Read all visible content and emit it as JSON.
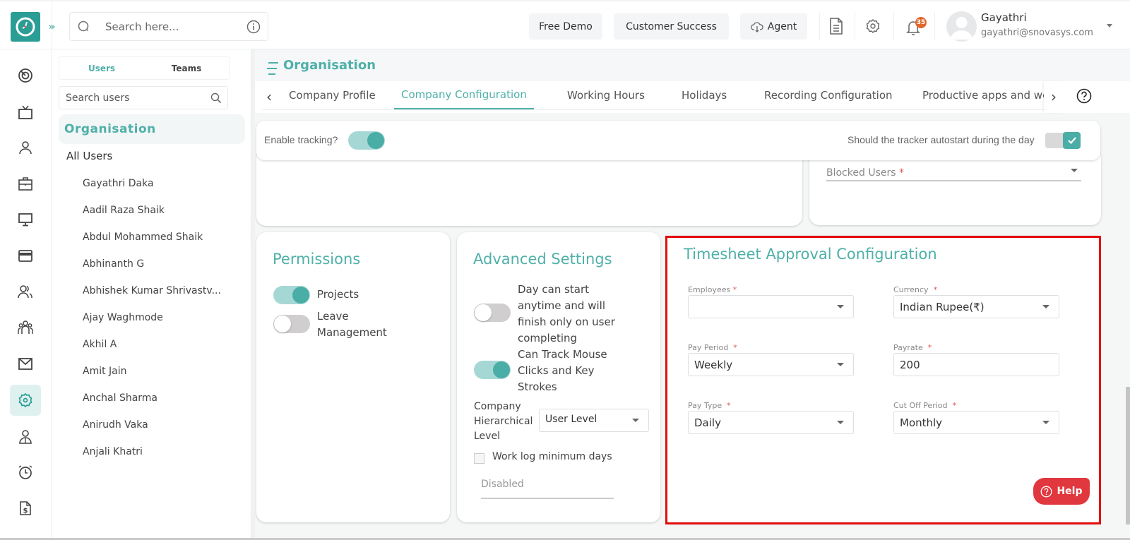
{
  "topbar": {
    "search_placeholder": "Search here...",
    "buttons": {
      "free_demo": "Free Demo",
      "customer_success": "Customer Success",
      "agent": "Agent"
    },
    "notification_count": "35",
    "user": {
      "name": "Gayathri",
      "email": "gayathri@snovasys.com"
    }
  },
  "rail": {
    "items": [
      {
        "icon": "target-icon"
      },
      {
        "icon": "tv-icon"
      },
      {
        "icon": "user-icon"
      },
      {
        "icon": "briefcase-icon"
      },
      {
        "icon": "monitor-icon"
      },
      {
        "icon": "credit-card-icon"
      },
      {
        "icon": "users-icon"
      },
      {
        "icon": "team-icon"
      },
      {
        "icon": "mail-icon"
      },
      {
        "icon": "settings-icon",
        "active": true
      },
      {
        "icon": "person-badge-icon"
      },
      {
        "icon": "alarm-icon"
      },
      {
        "icon": "invoice-icon"
      }
    ]
  },
  "users_panel": {
    "tabs": [
      "Users",
      "Teams"
    ],
    "active_tab": "Users",
    "search_placeholder": "Search users",
    "organisation": "Organisation",
    "all_users": "All Users",
    "users": [
      "Gayathri Daka",
      "Aadil Raza Shaik",
      "Abdul Mohammed Shaik",
      "Abhinanth G",
      "Abhishek Kumar Shrivastv...",
      "Ajay Waghmode",
      "Akhil A",
      "Amit Jain",
      "Anchal Sharma",
      "Anirudh Vaka",
      "Anjali Khatri"
    ]
  },
  "main": {
    "title": "Organisation",
    "tabs": [
      "Company Profile",
      "Company Configuration",
      "Working Hours",
      "Holidays",
      "Recording Configuration",
      "Productive apps and web"
    ],
    "active_tab": "Company Configuration",
    "tracking": {
      "enable_label": "Enable tracking?",
      "enable_on": true,
      "autostart_label": "Should the tracker autostart during the day",
      "autostart_checked": true
    },
    "blocked_users_label": "Blocked Users",
    "required_mark": "*",
    "permissions": {
      "title": "Permissions",
      "items": [
        {
          "label": "Projects",
          "on": true
        },
        {
          "label": "Leave Management",
          "on": false
        }
      ]
    },
    "advanced": {
      "title": "Advanced Settings",
      "items": [
        {
          "label": "Day can start anytime and will finish only on user completing",
          "on": false
        },
        {
          "label": "Can Track Mouse Clicks and Key Strokes",
          "on": true
        }
      ],
      "hierarchy_label": "Company Hierarchical Level",
      "hierarchy_value": "User Level",
      "worklog_label": "Work log minimum days",
      "worklog_checked": false,
      "worklog_placeholder": "Disabled"
    },
    "timesheet": {
      "title": "Timesheet Approval Configuration",
      "fields": {
        "employees": {
          "label": "Employees",
          "value": ""
        },
        "currency": {
          "label": "Currency",
          "value": "Indian Rupee(₹)"
        },
        "pay_period": {
          "label": "Pay Period",
          "value": "Weekly"
        },
        "payrate": {
          "label": "Payrate",
          "value": "200"
        },
        "pay_type": {
          "label": "Pay Type",
          "value": "Daily"
        },
        "cut_off_period": {
          "label": "Cut Off Period",
          "value": "Monthly"
        }
      }
    },
    "help_button": "Help"
  },
  "colors": {
    "accent": "#4fb0a9",
    "brand": "#2a9d95",
    "highlight": "#e30d0d",
    "help": "#e0383e",
    "badge": "#e2662c"
  }
}
